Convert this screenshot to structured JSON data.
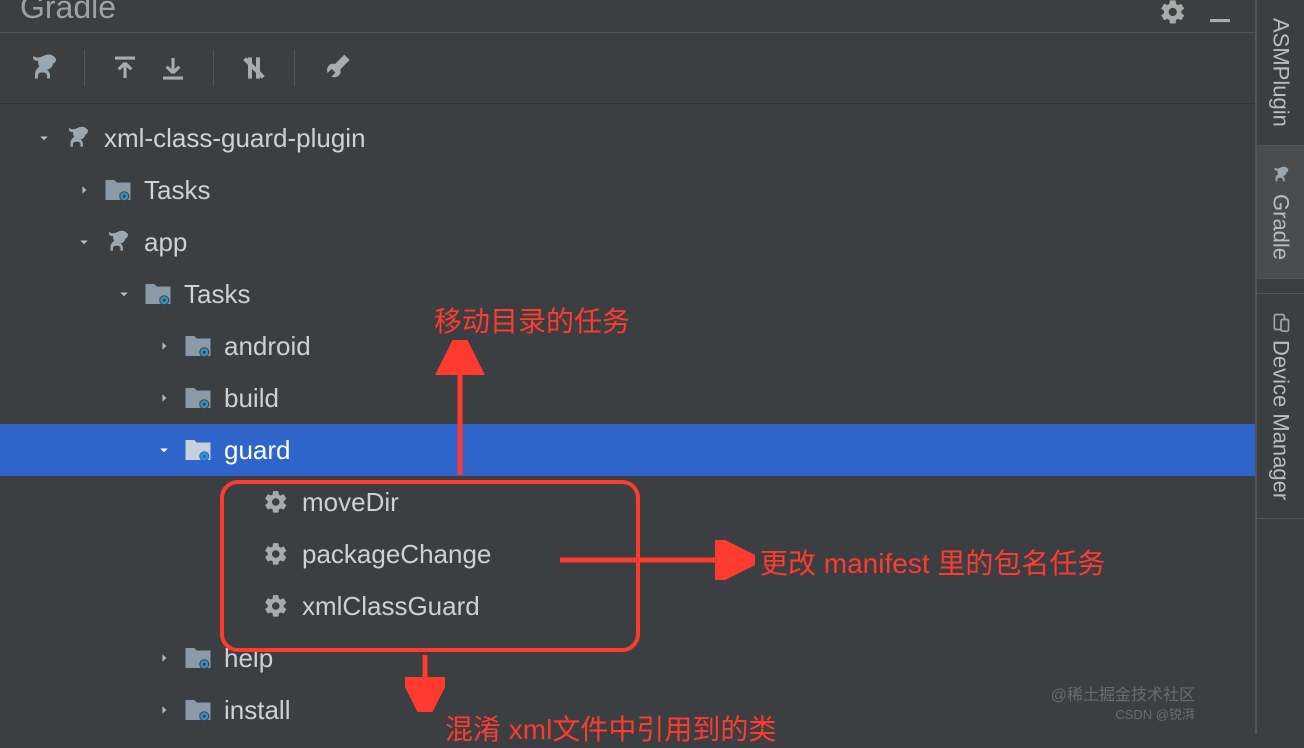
{
  "header": {
    "title": "Gradle"
  },
  "tree": {
    "root": "xml-class-guard-plugin",
    "items": {
      "tasks1": "Tasks",
      "app": "app",
      "tasks2": "Tasks",
      "android": "android",
      "build": "build",
      "guard": "guard",
      "moveDir": "moveDir",
      "packageChange": "packageChange",
      "xmlClassGuard": "xmlClassGuard",
      "help": "help",
      "install": "install"
    }
  },
  "sidebar": {
    "tabs": [
      "ASMPlugin",
      "Gradle",
      "Device Manager"
    ]
  },
  "annotations": {
    "top": "移动目录的任务",
    "right": "更改 manifest 里的包名任务",
    "bottom": "混淆 xml文件中引用到的类"
  },
  "watermark": {
    "line1": "@稀土掘金技术社区",
    "line2": "CSDN @锐湃"
  }
}
